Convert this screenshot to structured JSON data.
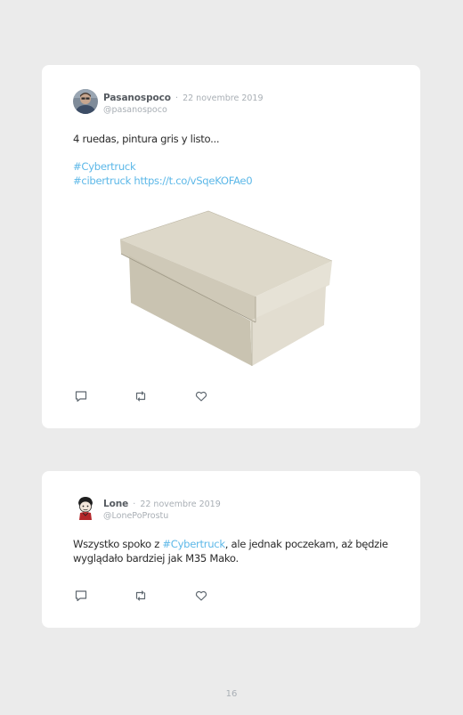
{
  "tweets": [
    {
      "name": "Pasanospoco",
      "separator": "·",
      "date": "22 novembre 2019",
      "handle": "@pasanospoco",
      "text_line1": "4 ruedas, pintura gris y listo...",
      "hashtag1": "#Cybertruck",
      "hashtag2": "#cibertruck",
      "url": "https://t.co/vSqeKOFAe0"
    },
    {
      "name": "Lone",
      "separator": "·",
      "date": "22 novembre 2019",
      "handle": "@LonePoProstu",
      "text_before": "Wszystko spoko z ",
      "hashtag": "#Cybertruck",
      "text_after": ", ale jednak poczekam, aż będzie wyglądało bardziej jak M35 Mako."
    }
  ],
  "page_number": "16",
  "colors": {
    "background": "#ebebeb",
    "card": "#ffffff",
    "link": "#5db8e8",
    "muted": "#a9afb5",
    "name": "#555a60"
  },
  "icons": [
    "reply-icon",
    "retweet-icon",
    "like-icon"
  ]
}
